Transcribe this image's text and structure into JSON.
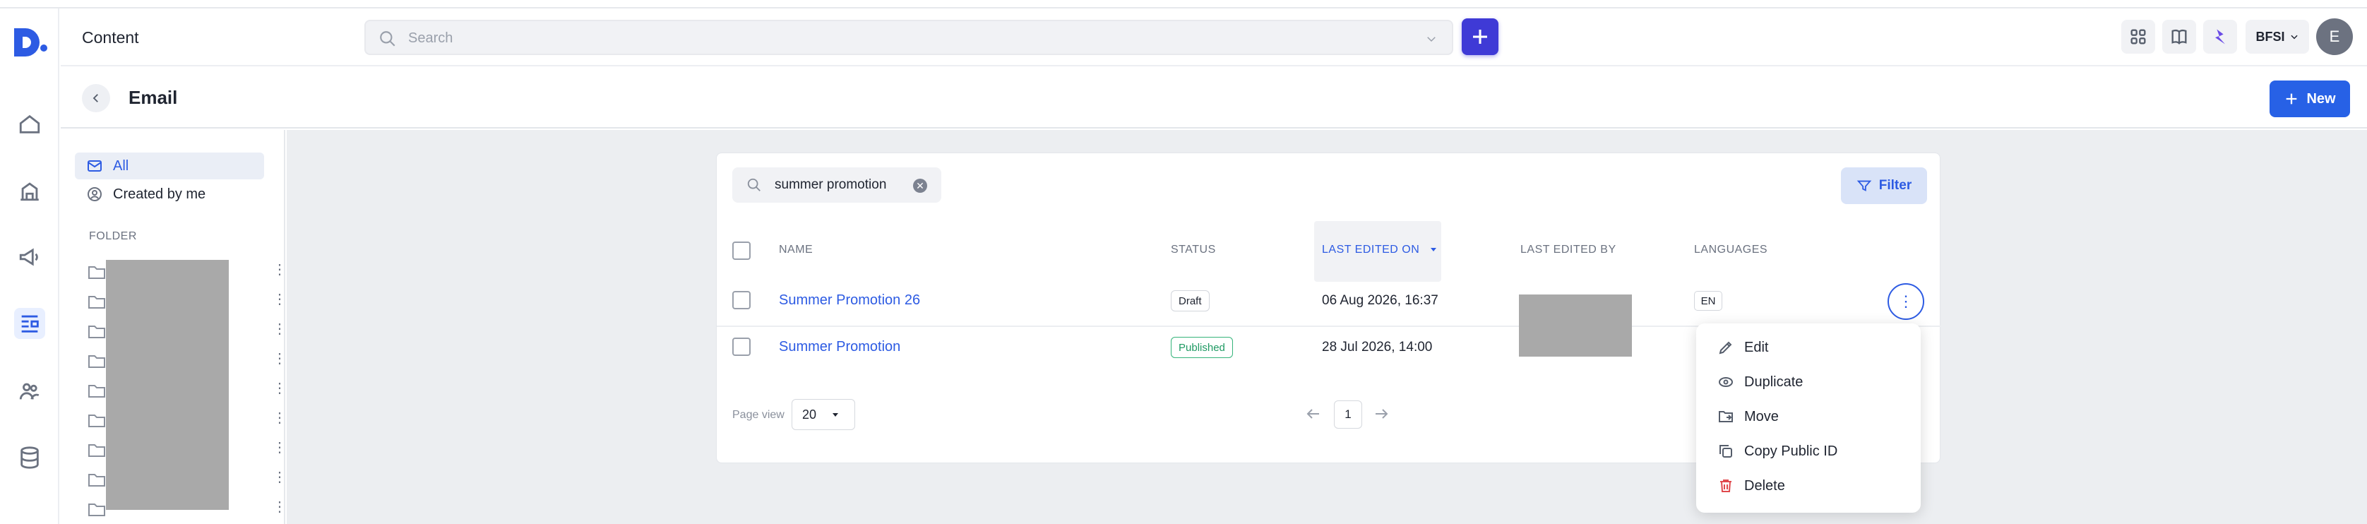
{
  "app": {
    "title": "Content"
  },
  "header": {
    "search_placeholder": "Search",
    "workspace": "BFSI",
    "avatar_initial": "E"
  },
  "page": {
    "title": "Email",
    "new_button": "New"
  },
  "sidebar": {
    "items": [
      {
        "label": "All",
        "icon": "mail-icon"
      },
      {
        "label": "Created by me",
        "icon": "user-circle-icon"
      }
    ],
    "folder_header": "FOLDER"
  },
  "toolbar": {
    "search_value": "summer promotion",
    "filter_label": "Filter"
  },
  "table": {
    "columns": [
      "NAME",
      "STATUS",
      "LAST EDITED ON",
      "LAST EDITED BY",
      "LANGUAGES"
    ],
    "sorted_column": "LAST EDITED ON",
    "rows": [
      {
        "name": "Summer Promotion 26",
        "status": "Draft",
        "last_edited_on": "06 Aug 2026, 16:37",
        "language": "EN"
      },
      {
        "name": "Summer Promotion",
        "status": "Published",
        "last_edited_on": "28 Jul 2026, 14:00",
        "language": ""
      }
    ]
  },
  "pagination": {
    "page_view_label": "Page view",
    "page_size": "20",
    "current_page": "1"
  },
  "context_menu": {
    "items": [
      "Edit",
      "Duplicate",
      "Move",
      "Copy Public ID",
      "Delete"
    ]
  },
  "colors": {
    "accent": "#2d5be3",
    "primary_button": "#2761e6",
    "plus_button": "#3f3ad6",
    "published": "#1f9a63",
    "delete": "#e0494d"
  }
}
